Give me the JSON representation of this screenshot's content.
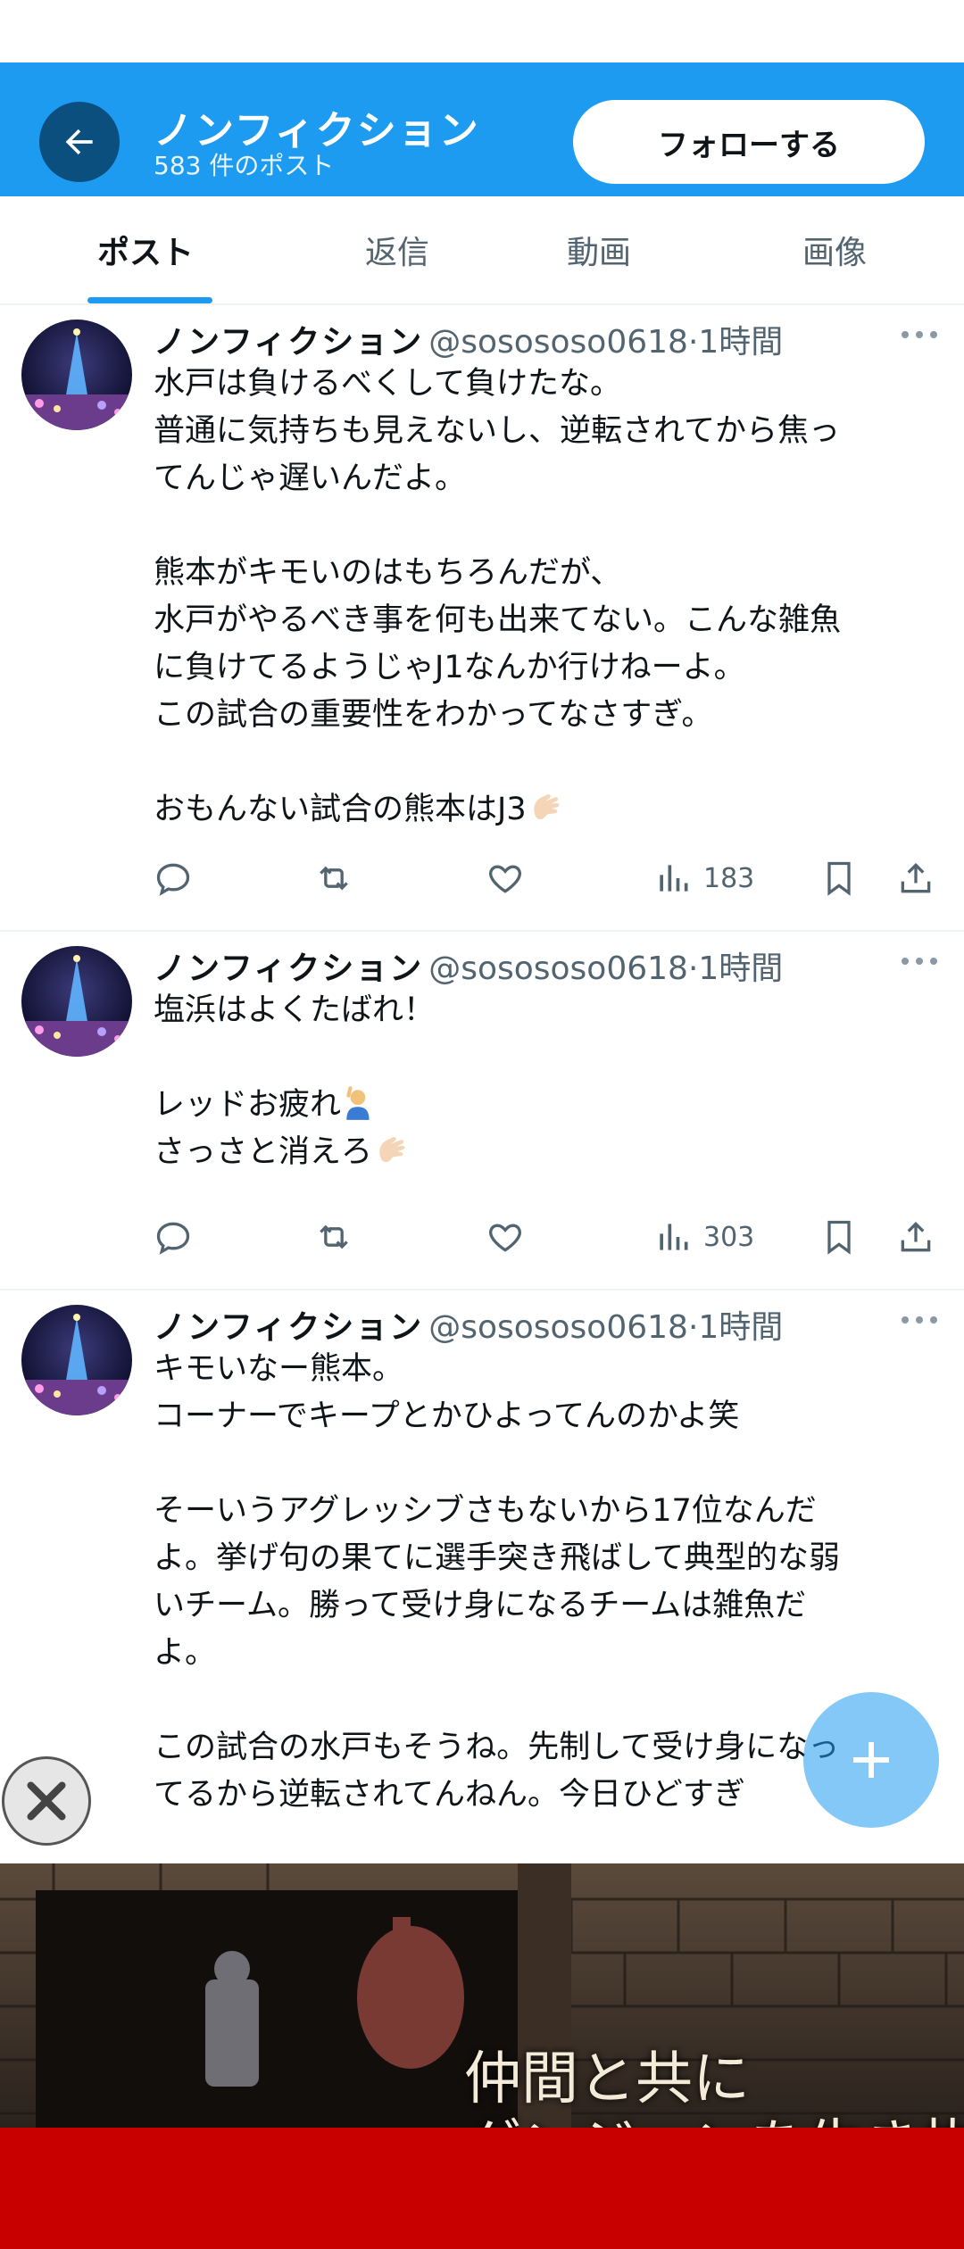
{
  "header": {
    "title": "ノンフィクション",
    "post_count": "583 件のポスト",
    "follow_label": "フォローする"
  },
  "tabs": [
    {
      "label": "ポスト",
      "active": true
    },
    {
      "label": "返信",
      "active": false
    },
    {
      "label": "動画",
      "active": false
    },
    {
      "label": "画像",
      "active": false
    }
  ],
  "posts": [
    {
      "name": "ノンフィクション",
      "handle": "@sosososo0618",
      "time": "·1時間",
      "lines": [
        "水戸は負けるべくして負けたな。",
        "普通に気持ちも見えないし、逆転されてから焦っ",
        "てんじゃ遅いんだよ。",
        "",
        "熊本がキモいのはもちろんだが、",
        "水戸がやるべき事を何も出来てない。こんな雑魚",
        "に負けてるようじゃJ1なんか行けねーよ。",
        "この試合の重要性をわかってなさすぎ。",
        "",
        "おもんない試合の熊本はJ3"
      ],
      "views": "183"
    },
    {
      "name": "ノンフィクション",
      "handle": "@sosososo0618",
      "time": "·1時間",
      "lines": [
        "塩浜はよくたばれ！",
        "",
        "レッドお疲れ",
        "さっさと消えろ"
      ],
      "views": "303"
    },
    {
      "name": "ノンフィクション",
      "handle": "@sosososo0618",
      "time": "·1時間",
      "lines": [
        "キモいなー熊本。",
        "コーナーでキープとかひよってんのかよ笑",
        "",
        "そーいうアグレッシブさもないから17位なんだ",
        "よ。挙げ句の果てに選手突き飛ばして典型的な弱",
        "いチーム。勝って受け身になるチームは雑魚だ",
        "よ。",
        "",
        "この試合の水戸もそうね。先制して受け身になっ",
        "てるから逆転されてんねん。今日ひどすぎ"
      ]
    }
  ],
  "ad": {
    "line1": "仲間と共に",
    "line2": "ダンジョンを生き抜け"
  },
  "colors": {
    "accent": "#1d9bf0",
    "text": "#0f1419",
    "muted": "#536471",
    "ad_bar": "#c80000"
  }
}
